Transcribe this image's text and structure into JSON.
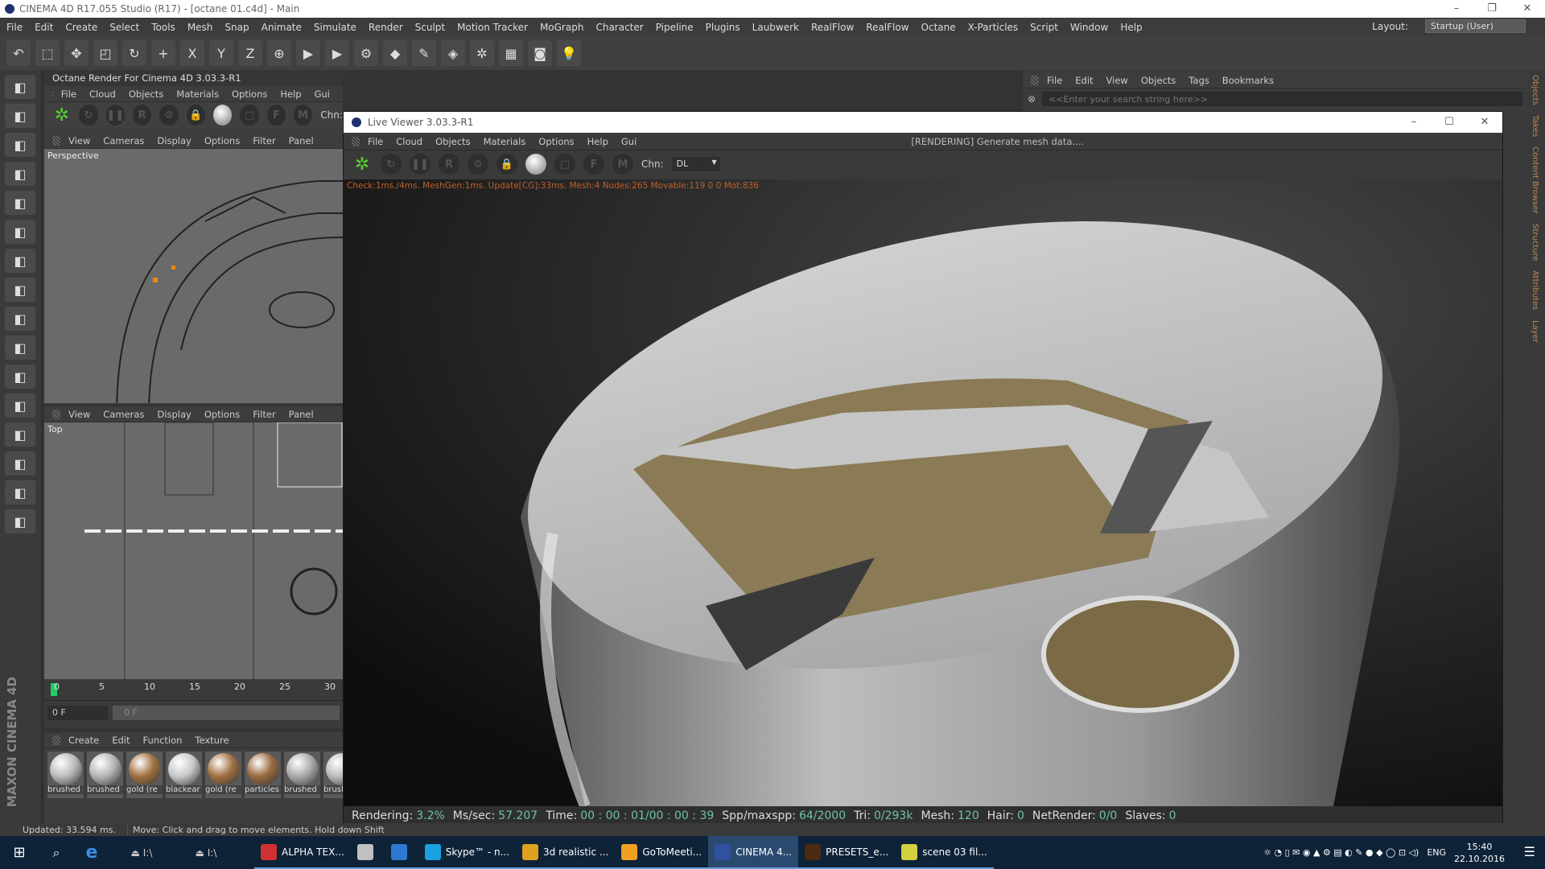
{
  "app": {
    "title": "CINEMA 4D R17.055 Studio (R17) - [octane 01.c4d] - Main",
    "window_controls": [
      "–",
      "❐",
      "✕"
    ]
  },
  "menu": [
    "File",
    "Edit",
    "Create",
    "Select",
    "Tools",
    "Mesh",
    "Snap",
    "Animate",
    "Simulate",
    "Render",
    "Sculpt",
    "Motion Tracker",
    "MoGraph",
    "Character",
    "Pipeline",
    "Plugins",
    "Laubwerk",
    "RealFlow",
    "RealFlow",
    "Octane",
    "X-Particles",
    "Script",
    "Window",
    "Help"
  ],
  "layout": {
    "label": "Layout:",
    "value": "Startup (User)"
  },
  "toolbar_icons": [
    "undo-icon",
    "live-selection-icon",
    "move-icon",
    "scale-icon",
    "rotate-icon",
    "add-icon",
    "x-axis-icon",
    "y-axis-icon",
    "z-axis-icon",
    "world-coord-icon",
    "render-view-icon",
    "render-picture-queue-icon",
    "render-settings-icon",
    "cube-icon",
    "pen-icon",
    "subdivision-icon",
    "array-icon",
    "floor-icon",
    "camera-icon",
    "light-icon"
  ],
  "toolbar_glyphs": [
    "↶",
    "⬚",
    "✥",
    "◰",
    "↻",
    "+",
    "X",
    "Y",
    "Z",
    "⊕",
    "▶",
    "▶",
    "⚙",
    "◆",
    "✎",
    "◈",
    "✲",
    "▦",
    "◙",
    "💡"
  ],
  "octane_panel": {
    "title": "Octane Render For Cinema 4D 3.03.3-R1",
    "menu": [
      "File",
      "Cloud",
      "Objects",
      "Materials",
      "Options",
      "Help",
      "Gui"
    ],
    "chn_label": "Chn:"
  },
  "viewport_persp": {
    "menu": [
      "View",
      "Cameras",
      "Display",
      "Options",
      "Filter",
      "Panel"
    ],
    "label": "Perspective"
  },
  "viewport_top": {
    "menu": [
      "View",
      "Cameras",
      "Display",
      "Options",
      "Filter",
      "Panel"
    ],
    "label": "Top"
  },
  "timeline": {
    "ticks": [
      "0",
      "5",
      "10",
      "15",
      "20",
      "25",
      "30"
    ],
    "current_frame": "0 F",
    "slider_value": "0 F"
  },
  "material_manager": {
    "menu": [
      "Create",
      "Edit",
      "Function",
      "Texture"
    ],
    "materials": [
      {
        "name": "brushed",
        "color": "#bbbbbb"
      },
      {
        "name": "brushed",
        "color": "#b5b5b5"
      },
      {
        "name": "gold (re",
        "color": "#a07040"
      },
      {
        "name": "blackear",
        "color": "#c8c8c8"
      },
      {
        "name": "gold (re",
        "color": "#a07040"
      },
      {
        "name": "particles",
        "color": "#9a6a40"
      },
      {
        "name": "brushed",
        "color": "#aaaaaa"
      },
      {
        "name": "brush",
        "color": "#bbbbbb"
      }
    ]
  },
  "maxon_logo": "MAXON CINEMA 4D",
  "live_viewer": {
    "title": "Live Viewer 3.03.3-R1",
    "window_controls": [
      "–",
      "☐",
      "✕"
    ],
    "menu": [
      "File",
      "Cloud",
      "Objects",
      "Materials",
      "Options",
      "Help",
      "Gui"
    ],
    "status": "[RENDERING] Generate mesh data....",
    "chn_label": "Chn:",
    "chn_value": "DL",
    "debug": "Check:1ms./4ms. MeshGen:1ms. Update[CG]:33ms. Mesh:4 Nodes:265 Movable:119  0 0 Mot:836",
    "stats": [
      {
        "key": "Rendering:",
        "value": "3.2%"
      },
      {
        "key": "Ms/sec:",
        "value": "57.207"
      },
      {
        "key": "Time:",
        "value": "00 : 00 : 01/00 : 00 : 39"
      },
      {
        "key": "Spp/maxspp:",
        "value": "64/2000"
      },
      {
        "key": "Tri:",
        "value": "0/293k"
      },
      {
        "key": "Mesh:",
        "value": "120"
      },
      {
        "key": "Hair:",
        "value": "0"
      },
      {
        "key": "NetRender:",
        "value": "0/0"
      },
      {
        "key": "Slaves:",
        "value": "0"
      }
    ],
    "progress_percent": 3.2,
    "accent": "#26c76a"
  },
  "objects_panel": {
    "menu": [
      "File",
      "Edit",
      "View",
      "Objects",
      "Tags",
      "Bookmarks"
    ],
    "search_placeholder": "<<Enter your search string here>>"
  },
  "side_tabs": [
    "Objects",
    "Takes",
    "Content Browser",
    "Structure",
    "Attributes",
    "Layer"
  ],
  "statusbar": {
    "updated": "Updated: 33.594 ms.",
    "hint": "Move: Click and drag to move elements. Hold down Shift"
  },
  "taskbar": {
    "items": [
      {
        "label": "ALPHA TEX...",
        "color": "#d03030"
      },
      {
        "label": "",
        "color": "#c0c0c0"
      },
      {
        "label": "",
        "color": "#2a7ad0"
      },
      {
        "label": "Skype™ - n...",
        "color": "#1aa0e0"
      },
      {
        "label": "3d realistic ...",
        "color": "#e0a020"
      },
      {
        "label": "GoToMeeti...",
        "color": "#f0a020"
      },
      {
        "label": "CINEMA 4...",
        "color": "#3050a0",
        "active": true
      },
      {
        "label": "PRESETS_e...",
        "color": "#4a2a10"
      },
      {
        "label": "scene 03 fil...",
        "color": "#d0d040"
      }
    ],
    "language": "ENG",
    "time": "15:40",
    "date": "22.10.2016"
  }
}
